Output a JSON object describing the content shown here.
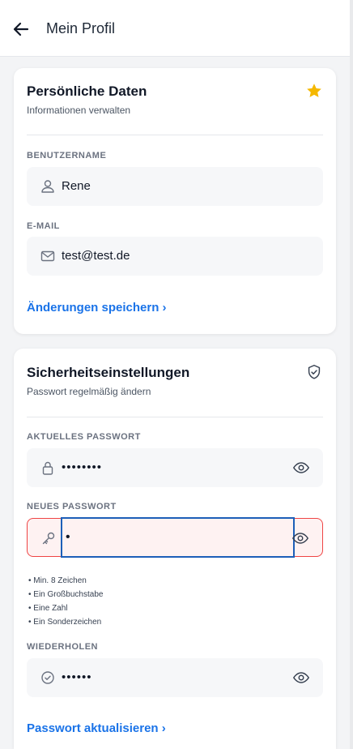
{
  "header": {
    "title": "Mein Profil",
    "back_icon": "arrow-left-icon"
  },
  "personal": {
    "title": "Persönliche Daten",
    "subtitle": "Informationen verwalten",
    "star_icon": "star-icon",
    "star_color": "#f5b800",
    "username_label": "BENUTZERNAME",
    "username_value": "Rene",
    "email_label": "E-MAIL",
    "email_value": "test@test.de",
    "save_link": "Änderungen speichern ›"
  },
  "security": {
    "title": "Sicherheitseinstellungen",
    "subtitle": "Passwort regelmäßig ändern",
    "current_label": "AKTUELLES PASSWORT",
    "current_value": "••••••••",
    "new_label": "NEUES PASSWORT",
    "new_value": "•",
    "requirements": [
      "• Min. 8 Zeichen",
      "• Ein Großbuchstabe",
      "• Eine Zahl",
      "• Ein Sonderzeichen"
    ],
    "repeat_label": "WIEDERHOLEN",
    "repeat_placeholder": "••••••",
    "update_link": "Passwort aktualisieren ›",
    "error_color": "#ef4444",
    "accent_color": "#1a73e8"
  }
}
